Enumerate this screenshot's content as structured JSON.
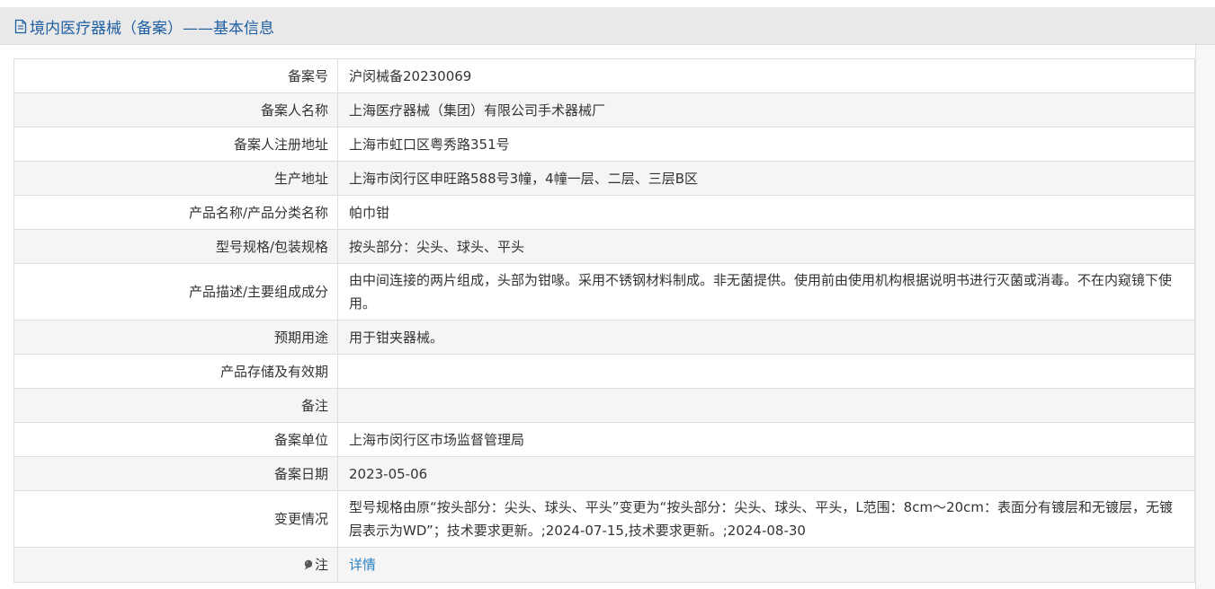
{
  "header": {
    "title": "境内医疗器械（备案）——基本信息",
    "icon": "document-icon"
  },
  "rows": [
    {
      "label": "备案号",
      "value": "沪闵械备20230069"
    },
    {
      "label": "备案人名称",
      "value": "上海医疗器械（集团）有限公司手术器械厂"
    },
    {
      "label": "备案人注册地址",
      "value": "上海市虹口区粤秀路351号"
    },
    {
      "label": "生产地址",
      "value": "上海市闵行区申旺路588号3幢，4幢一层、二层、三层B区"
    },
    {
      "label": "产品名称/产品分类名称",
      "value": "帕巾钳"
    },
    {
      "label": "型号规格/包装规格",
      "value": "按头部分：尖头、球头、平头"
    },
    {
      "label": "产品描述/主要组成成分",
      "value": "由中间连接的两片组成，头部为钳喙。采用不锈钢材料制成。非无菌提供。使用前由使用机构根据说明书进行灭菌或消毒。不在内窥镜下使用。"
    },
    {
      "label": "预期用途",
      "value": "用于钳夹器械。"
    },
    {
      "label": "产品存储及有效期",
      "value": ""
    },
    {
      "label": "备注",
      "value": ""
    },
    {
      "label": "备案单位",
      "value": "上海市闵行区市场监督管理局"
    },
    {
      "label": "备案日期",
      "value": "2023-05-06"
    },
    {
      "label": "变更情况",
      "value": "型号规格由原“按头部分：尖头、球头、平头”变更为“按头部分：尖头、球头、平头，L范围：8cm～20cm：表面分有镀层和无镀层，无镀层表示为WD”；技术要求更新。;2024-07-15,技术要求更新。;2024-08-30"
    },
    {
      "label": "注",
      "value": "详情",
      "icon": "pin-icon"
    }
  ],
  "colors": {
    "title": "#1f5fa3",
    "link": "#2a7fc1",
    "stripe": "#f5f5f5"
  }
}
